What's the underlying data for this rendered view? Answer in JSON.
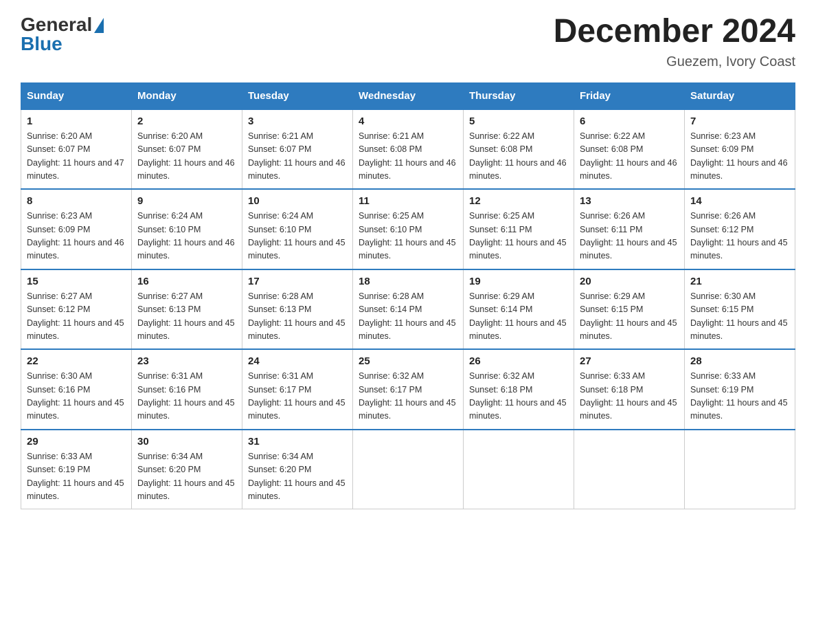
{
  "header": {
    "logo_general": "General",
    "logo_blue": "Blue",
    "month_title": "December 2024",
    "location": "Guezem, Ivory Coast"
  },
  "days_of_week": [
    "Sunday",
    "Monday",
    "Tuesday",
    "Wednesday",
    "Thursday",
    "Friday",
    "Saturday"
  ],
  "weeks": [
    [
      {
        "day": "1",
        "sunrise": "6:20 AM",
        "sunset": "6:07 PM",
        "daylight": "11 hours and 47 minutes."
      },
      {
        "day": "2",
        "sunrise": "6:20 AM",
        "sunset": "6:07 PM",
        "daylight": "11 hours and 46 minutes."
      },
      {
        "day": "3",
        "sunrise": "6:21 AM",
        "sunset": "6:07 PM",
        "daylight": "11 hours and 46 minutes."
      },
      {
        "day": "4",
        "sunrise": "6:21 AM",
        "sunset": "6:08 PM",
        "daylight": "11 hours and 46 minutes."
      },
      {
        "day": "5",
        "sunrise": "6:22 AM",
        "sunset": "6:08 PM",
        "daylight": "11 hours and 46 minutes."
      },
      {
        "day": "6",
        "sunrise": "6:22 AM",
        "sunset": "6:08 PM",
        "daylight": "11 hours and 46 minutes."
      },
      {
        "day": "7",
        "sunrise": "6:23 AM",
        "sunset": "6:09 PM",
        "daylight": "11 hours and 46 minutes."
      }
    ],
    [
      {
        "day": "8",
        "sunrise": "6:23 AM",
        "sunset": "6:09 PM",
        "daylight": "11 hours and 46 minutes."
      },
      {
        "day": "9",
        "sunrise": "6:24 AM",
        "sunset": "6:10 PM",
        "daylight": "11 hours and 46 minutes."
      },
      {
        "day": "10",
        "sunrise": "6:24 AM",
        "sunset": "6:10 PM",
        "daylight": "11 hours and 45 minutes."
      },
      {
        "day": "11",
        "sunrise": "6:25 AM",
        "sunset": "6:10 PM",
        "daylight": "11 hours and 45 minutes."
      },
      {
        "day": "12",
        "sunrise": "6:25 AM",
        "sunset": "6:11 PM",
        "daylight": "11 hours and 45 minutes."
      },
      {
        "day": "13",
        "sunrise": "6:26 AM",
        "sunset": "6:11 PM",
        "daylight": "11 hours and 45 minutes."
      },
      {
        "day": "14",
        "sunrise": "6:26 AM",
        "sunset": "6:12 PM",
        "daylight": "11 hours and 45 minutes."
      }
    ],
    [
      {
        "day": "15",
        "sunrise": "6:27 AM",
        "sunset": "6:12 PM",
        "daylight": "11 hours and 45 minutes."
      },
      {
        "day": "16",
        "sunrise": "6:27 AM",
        "sunset": "6:13 PM",
        "daylight": "11 hours and 45 minutes."
      },
      {
        "day": "17",
        "sunrise": "6:28 AM",
        "sunset": "6:13 PM",
        "daylight": "11 hours and 45 minutes."
      },
      {
        "day": "18",
        "sunrise": "6:28 AM",
        "sunset": "6:14 PM",
        "daylight": "11 hours and 45 minutes."
      },
      {
        "day": "19",
        "sunrise": "6:29 AM",
        "sunset": "6:14 PM",
        "daylight": "11 hours and 45 minutes."
      },
      {
        "day": "20",
        "sunrise": "6:29 AM",
        "sunset": "6:15 PM",
        "daylight": "11 hours and 45 minutes."
      },
      {
        "day": "21",
        "sunrise": "6:30 AM",
        "sunset": "6:15 PM",
        "daylight": "11 hours and 45 minutes."
      }
    ],
    [
      {
        "day": "22",
        "sunrise": "6:30 AM",
        "sunset": "6:16 PM",
        "daylight": "11 hours and 45 minutes."
      },
      {
        "day": "23",
        "sunrise": "6:31 AM",
        "sunset": "6:16 PM",
        "daylight": "11 hours and 45 minutes."
      },
      {
        "day": "24",
        "sunrise": "6:31 AM",
        "sunset": "6:17 PM",
        "daylight": "11 hours and 45 minutes."
      },
      {
        "day": "25",
        "sunrise": "6:32 AM",
        "sunset": "6:17 PM",
        "daylight": "11 hours and 45 minutes."
      },
      {
        "day": "26",
        "sunrise": "6:32 AM",
        "sunset": "6:18 PM",
        "daylight": "11 hours and 45 minutes."
      },
      {
        "day": "27",
        "sunrise": "6:33 AM",
        "sunset": "6:18 PM",
        "daylight": "11 hours and 45 minutes."
      },
      {
        "day": "28",
        "sunrise": "6:33 AM",
        "sunset": "6:19 PM",
        "daylight": "11 hours and 45 minutes."
      }
    ],
    [
      {
        "day": "29",
        "sunrise": "6:33 AM",
        "sunset": "6:19 PM",
        "daylight": "11 hours and 45 minutes."
      },
      {
        "day": "30",
        "sunrise": "6:34 AM",
        "sunset": "6:20 PM",
        "daylight": "11 hours and 45 minutes."
      },
      {
        "day": "31",
        "sunrise": "6:34 AM",
        "sunset": "6:20 PM",
        "daylight": "11 hours and 45 minutes."
      },
      null,
      null,
      null,
      null
    ]
  ]
}
